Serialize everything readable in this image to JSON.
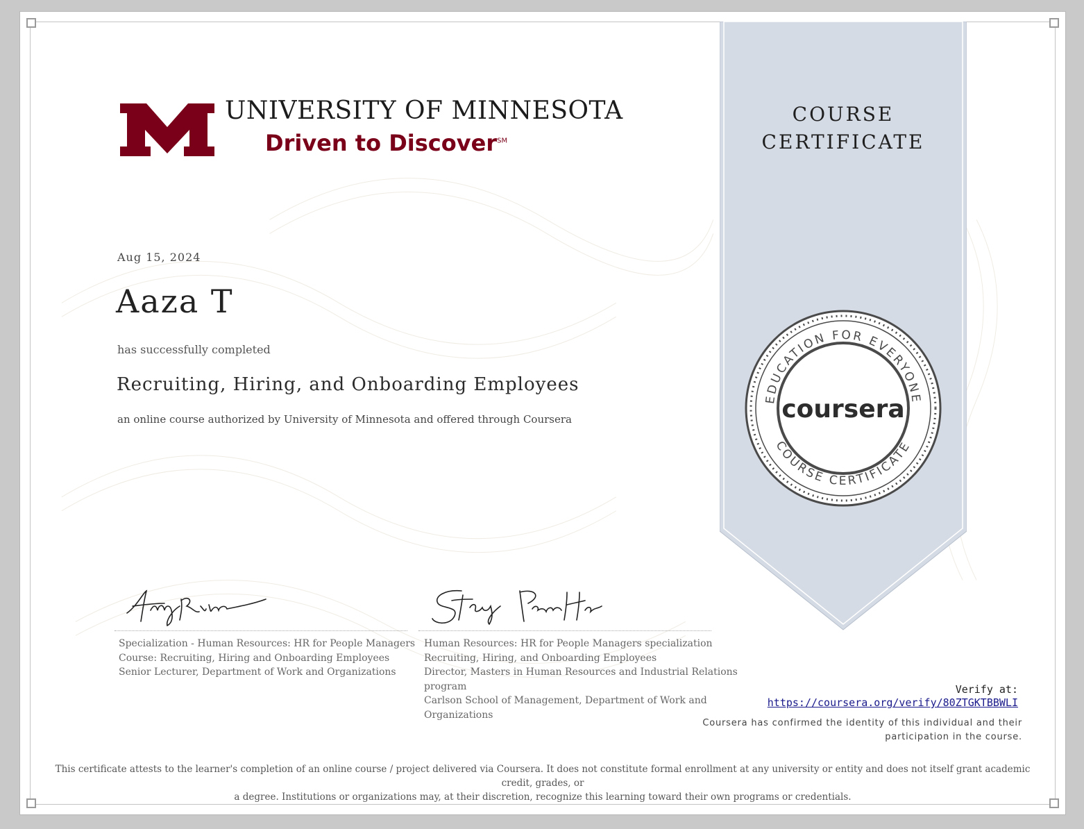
{
  "colors": {
    "ribbon": "#d5dbe4",
    "brand_maroon": "#7a0019",
    "seal": "#4a4a4a",
    "link": "#1a1a8c"
  },
  "logo": {
    "name": "UNIVERSITY OF MINNESOTA",
    "tagline": "Driven to Discover",
    "tagline_mark": "SM"
  },
  "ribbon": {
    "title_line1": "COURSE",
    "title_line2": "CERTIFICATE"
  },
  "seal": {
    "top_text": "EDUCATION FOR EVERYONE",
    "center_text": "coursera",
    "bottom_text": "COURSE CERTIFICATE"
  },
  "certificate": {
    "date": "Aug 15, 2024",
    "learner_name": "Aaza T",
    "completed_text": "has successfully completed",
    "course_title": "Recruiting, Hiring, and Onboarding Employees",
    "authorized_text": "an online course authorized by University of Minnesota and offered through Coursera"
  },
  "signatures": [
    {
      "signature": "Amy Frein",
      "lines": [
        "Specialization - Human Resources: HR for People Managers",
        "Course: Recruiting, Hiring and Onboarding Employees",
        "Senior Lecturer, Department of Work and Organizations"
      ]
    },
    {
      "signature": "Stacy Doepner-Hove",
      "lines": [
        "Human Resources: HR for People Managers specialization",
        "Recruiting, Hiring, and Onboarding Employees",
        "Director, Masters in Human Resources and Industrial Relations",
        "program",
        "Carlson School of Management, Department of Work and",
        "Organizations"
      ]
    }
  ],
  "verify": {
    "label": "Verify at:",
    "url": "https://coursera.org/verify/80ZTGKTBBWLI",
    "confirm_line1": "Coursera has confirmed the identity of this individual and their",
    "confirm_line2": "participation in the course."
  },
  "disclaimer": {
    "line1": "This certificate attests to the learner's completion of an online course / project delivered via Coursera. It does not constitute formal enrollment at any university or entity and does not itself grant academic credit, grades, or",
    "line2": "a degree. Institutions or organizations may, at their discretion, recognize this learning toward their own programs or credentials."
  }
}
